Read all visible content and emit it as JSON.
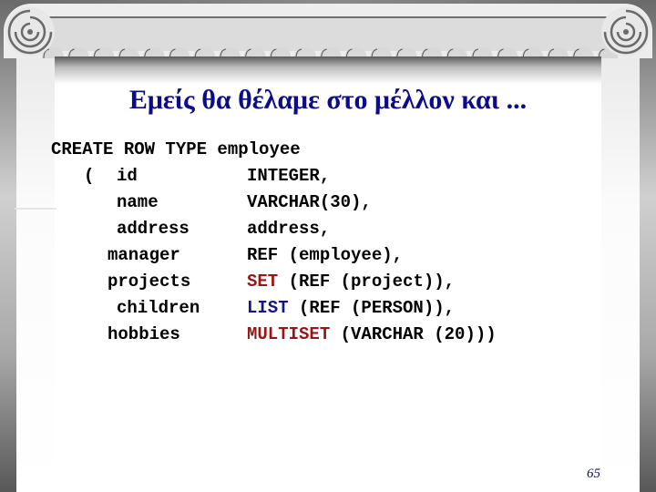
{
  "slide": {
    "title": "Εμείς θα θέλαμε στο μέλλον και ...",
    "page_number": "65",
    "decoration": "ionic-column-frame"
  },
  "code": {
    "header": "CREATE ROW TYPE employee",
    "open_paren": "(",
    "fields": [
      {
        "name": "id",
        "type_parts": [
          {
            "text": "INTEGER,",
            "color": "black"
          }
        ]
      },
      {
        "name": "name",
        "type_parts": [
          {
            "text": "VARCHAR(30),",
            "color": "black"
          }
        ]
      },
      {
        "name": "address",
        "type_parts": [
          {
            "text": "address,",
            "color": "black"
          }
        ]
      },
      {
        "name": "manager",
        "type_parts": [
          {
            "text": "REF (employee),",
            "color": "black"
          }
        ]
      },
      {
        "name": "projects",
        "type_parts": [
          {
            "text": "SET",
            "color": "#9b1414"
          },
          {
            "text": " (REF (project)),",
            "color": "black"
          }
        ]
      },
      {
        "name": "children",
        "type_parts": [
          {
            "text": "LIST",
            "color": "#14148c"
          },
          {
            "text": " (REF (PERSON)),",
            "color": "black"
          }
        ]
      },
      {
        "name": "hobbies",
        "type_parts": [
          {
            "text": "MULTISET",
            "color": "#9b1414"
          },
          {
            "text": " (VARCHAR (20)))",
            "color": "black"
          }
        ]
      }
    ]
  },
  "colors": {
    "title": "#0b0b8c",
    "keyword_red": "#9b1414",
    "keyword_blue": "#14148c"
  }
}
